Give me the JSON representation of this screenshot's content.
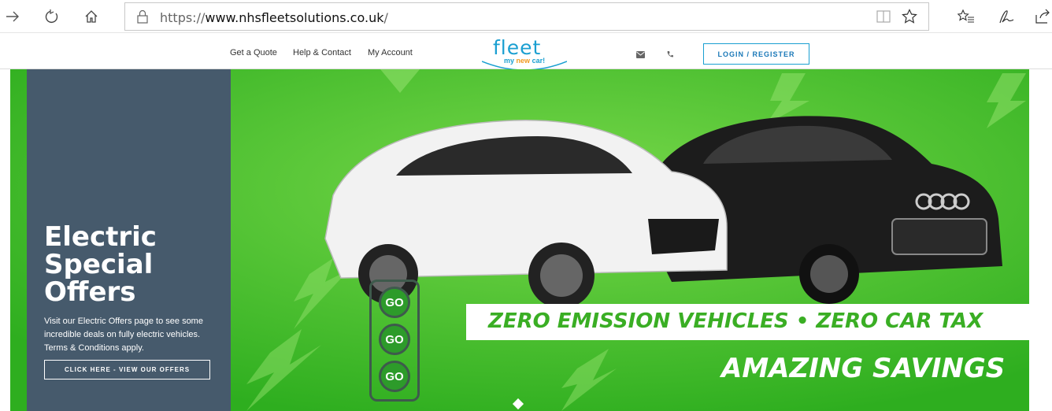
{
  "browser": {
    "url_proto": "https://",
    "url_host": "www.nhsfleetsolutions.co.uk",
    "url_path": "/"
  },
  "header": {
    "nav": [
      "Get a Quote",
      "Help & Contact",
      "My Account"
    ],
    "logo_main": "fleet",
    "logo_sub_my": "my",
    "logo_sub_new": "new",
    "logo_sub_car": "car!",
    "login_label": "LOGIN / REGISTER"
  },
  "hero": {
    "panel_title_1": "Electric",
    "panel_title_2": "Special",
    "panel_title_3": "Offers",
    "panel_desc": "Visit our Electric Offers page to see some incredible deals on fully electric vehicles. Terms & Conditions apply.",
    "offers_button": "CLICK HERE - VIEW OUR OFFERS",
    "go_label": "GO",
    "strip_text": "ZERO EMISSION VEHICLES  •  ZERO CAR TAX",
    "savings_text": "AMAZING SAVINGS"
  },
  "colors": {
    "hero_green": "#3fbf2a",
    "panel_slate": "#465a6c",
    "brand_blue": "#1a9fd1"
  }
}
